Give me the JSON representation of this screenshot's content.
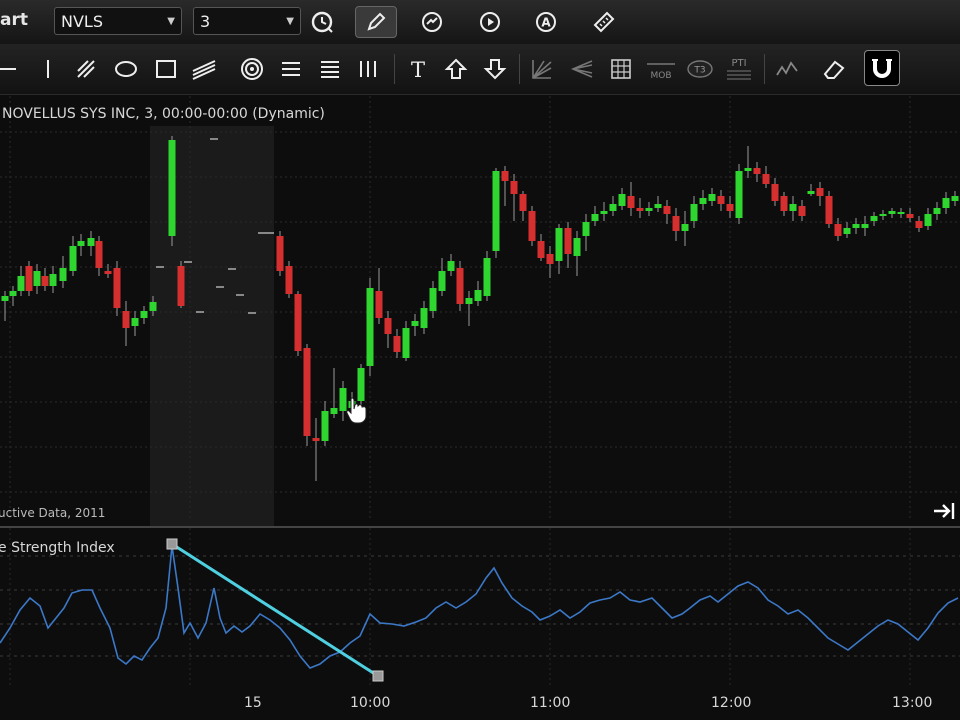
{
  "toolbar": {
    "title_fragment": "art",
    "symbol": "NVLS",
    "interval": "3",
    "buttons": [
      "clock-icon",
      "pencil-icon",
      "refresh-icon",
      "play-icon",
      "auto-icon",
      "ruler-icon"
    ],
    "drawing_tools": [
      "horizontal-line-icon",
      "vertical-line-icon",
      "trendline-icon",
      "ellipse-icon",
      "rectangle-icon",
      "channel-icon",
      "target-icon",
      "lines-icon",
      "equal-lines-icon",
      "vertical-bars-icon",
      "text-icon",
      "arrow-up-icon",
      "arrow-down-icon",
      "gann-fan-icon",
      "fib-fan-icon",
      "grid-icon",
      "mob-icon",
      "t3-icon",
      "pti-icon",
      "zigzag-icon",
      "eraser-icon",
      "magnet-icon"
    ],
    "mob_label": "MOB",
    "t3_label": "T3",
    "pti_label": "PTI"
  },
  "chart": {
    "header": "NOVELLUS SYS INC, 3, 00:00-00:00 (Dynamic)",
    "copyright": "uctive Data, 2011",
    "colors": {
      "up": "#2fd62f",
      "down": "#d62f2f",
      "background": "#0d0d0d",
      "grid": "#2a2a2a",
      "shaded": "#1c1c1c"
    }
  },
  "oscillator": {
    "title": "e Strength Index",
    "line_color": "#3c78c8",
    "trendline_color": "#4fd0e0"
  },
  "time_axis": {
    "labels": [
      "15",
      "10:00",
      "11:00",
      "12:00",
      "13:00"
    ]
  }
}
